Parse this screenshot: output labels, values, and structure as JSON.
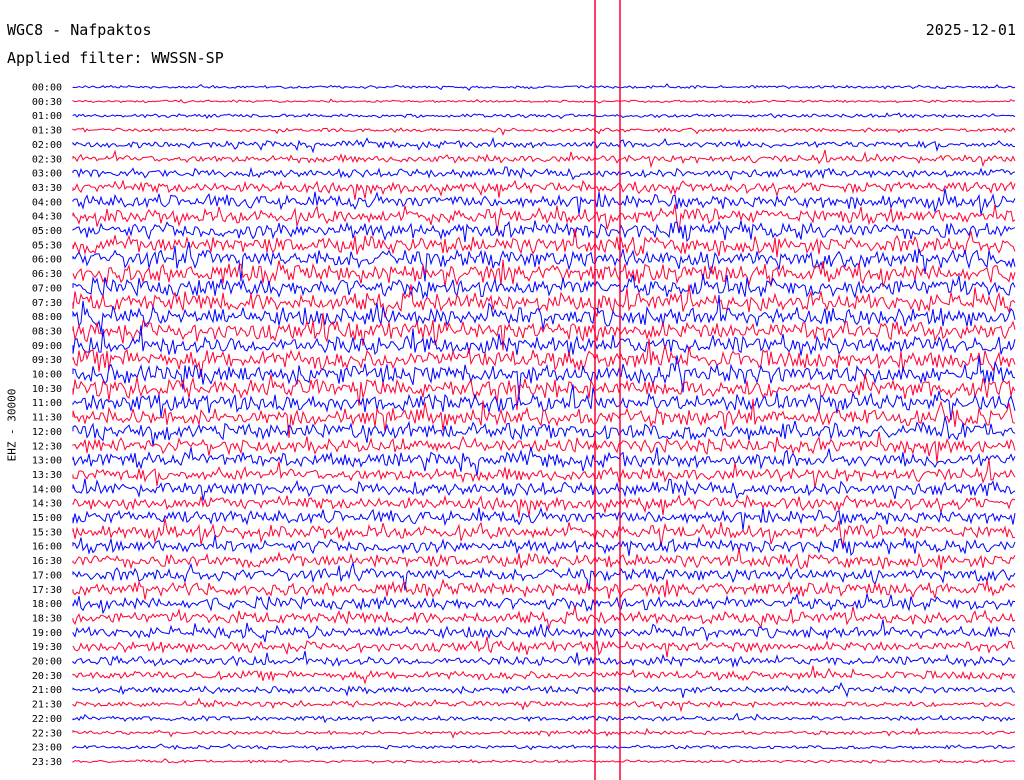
{
  "header": {
    "station": "WGC8 - Nafpaktos",
    "filter": "Applied filter: WWSSN-SP",
    "date": "2025-12-01"
  },
  "colors": {
    "even_trace": "#0000ff",
    "odd_trace": "#ff0033",
    "marker": "#ff0033",
    "background": "#ffffff"
  },
  "chart_data": {
    "type": "helicorder",
    "title": "WGC8 - Nafpaktos",
    "subtitle": "Applied filter: WWSSN-SP",
    "date": "2025-12-01",
    "ylabel": "EHZ - 30000",
    "row_minutes": 30,
    "trace_color_cycle": [
      "#0000ff",
      "#ff0033"
    ],
    "row_labels": [
      "00:00",
      "00:30",
      "01:00",
      "01:30",
      "02:00",
      "02:30",
      "03:00",
      "03:30",
      "04:00",
      "04:30",
      "05:00",
      "05:30",
      "06:00",
      "06:30",
      "07:00",
      "07:30",
      "08:00",
      "08:30",
      "09:00",
      "09:30",
      "10:00",
      "10:30",
      "11:00",
      "11:30",
      "12:00",
      "12:30",
      "13:00",
      "13:30",
      "14:00",
      "14:30",
      "15:00",
      "15:30",
      "16:00",
      "16:30",
      "17:00",
      "17:30",
      "18:00",
      "18:30",
      "19:00",
      "19:30",
      "20:00",
      "20:30",
      "21:00",
      "21:30",
      "22:00",
      "22:30",
      "23:00",
      "23:30"
    ],
    "relative_amplitude": [
      0.15,
      0.12,
      0.18,
      0.2,
      0.35,
      0.4,
      0.45,
      0.6,
      0.7,
      0.75,
      0.85,
      0.9,
      1.0,
      1.0,
      1.0,
      1.0,
      1.0,
      1.0,
      1.0,
      1.0,
      1.0,
      1.0,
      0.95,
      0.9,
      0.85,
      0.8,
      0.75,
      0.7,
      0.7,
      0.7,
      0.7,
      0.7,
      0.7,
      0.7,
      0.7,
      0.7,
      0.7,
      0.65,
      0.6,
      0.55,
      0.5,
      0.45,
      0.35,
      0.3,
      0.25,
      0.2,
      0.18,
      0.15
    ],
    "grid": false
  }
}
